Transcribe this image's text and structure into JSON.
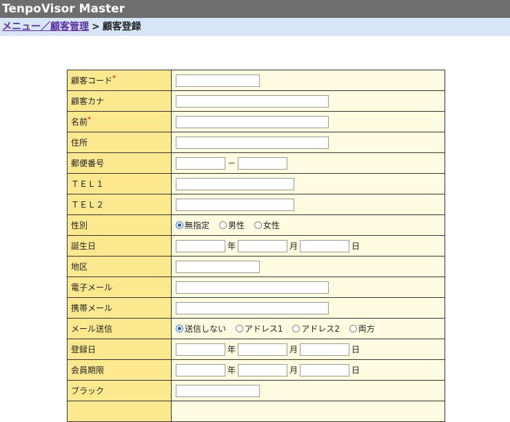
{
  "app_title": "TenpoVisor Master",
  "breadcrumb": {
    "link": "メニュー／顧客管理",
    "separator": ">",
    "current": "顧客登録"
  },
  "required_mark": "*",
  "fields": {
    "customer_code": {
      "label": "顧客コード",
      "value": ""
    },
    "customer_kana": {
      "label": "顧客カナ",
      "value": ""
    },
    "name": {
      "label": "名前",
      "value": ""
    },
    "address": {
      "label": "住所",
      "value": ""
    },
    "postal": {
      "label": "郵便番号",
      "value1": "",
      "value2": "",
      "sep": "－"
    },
    "tel1": {
      "label": "ＴＥＬ１",
      "value": ""
    },
    "tel2": {
      "label": "ＴＥＬ２",
      "value": ""
    },
    "gender": {
      "label": "性別",
      "options": [
        "無指定",
        "男性",
        "女性"
      ],
      "selected": 0
    },
    "birthday": {
      "label": "誕生日",
      "year": "年",
      "month": "月",
      "day": "日"
    },
    "region": {
      "label": "地区",
      "value": ""
    },
    "email": {
      "label": "電子メール",
      "value": ""
    },
    "mobile_mail": {
      "label": "携帯メール",
      "value": ""
    },
    "mail_send": {
      "label": "メール送信",
      "options": [
        "送信しない",
        "アドレス1",
        "アドレス2",
        "両方"
      ],
      "selected": 0
    },
    "register_date": {
      "label": "登録日",
      "year": "年",
      "month": "月",
      "day": "日"
    },
    "member_expiry": {
      "label": "会員期限",
      "year": "年",
      "month": "月",
      "day": "日"
    },
    "blacklist": {
      "label": "ブラック",
      "value": ""
    }
  }
}
